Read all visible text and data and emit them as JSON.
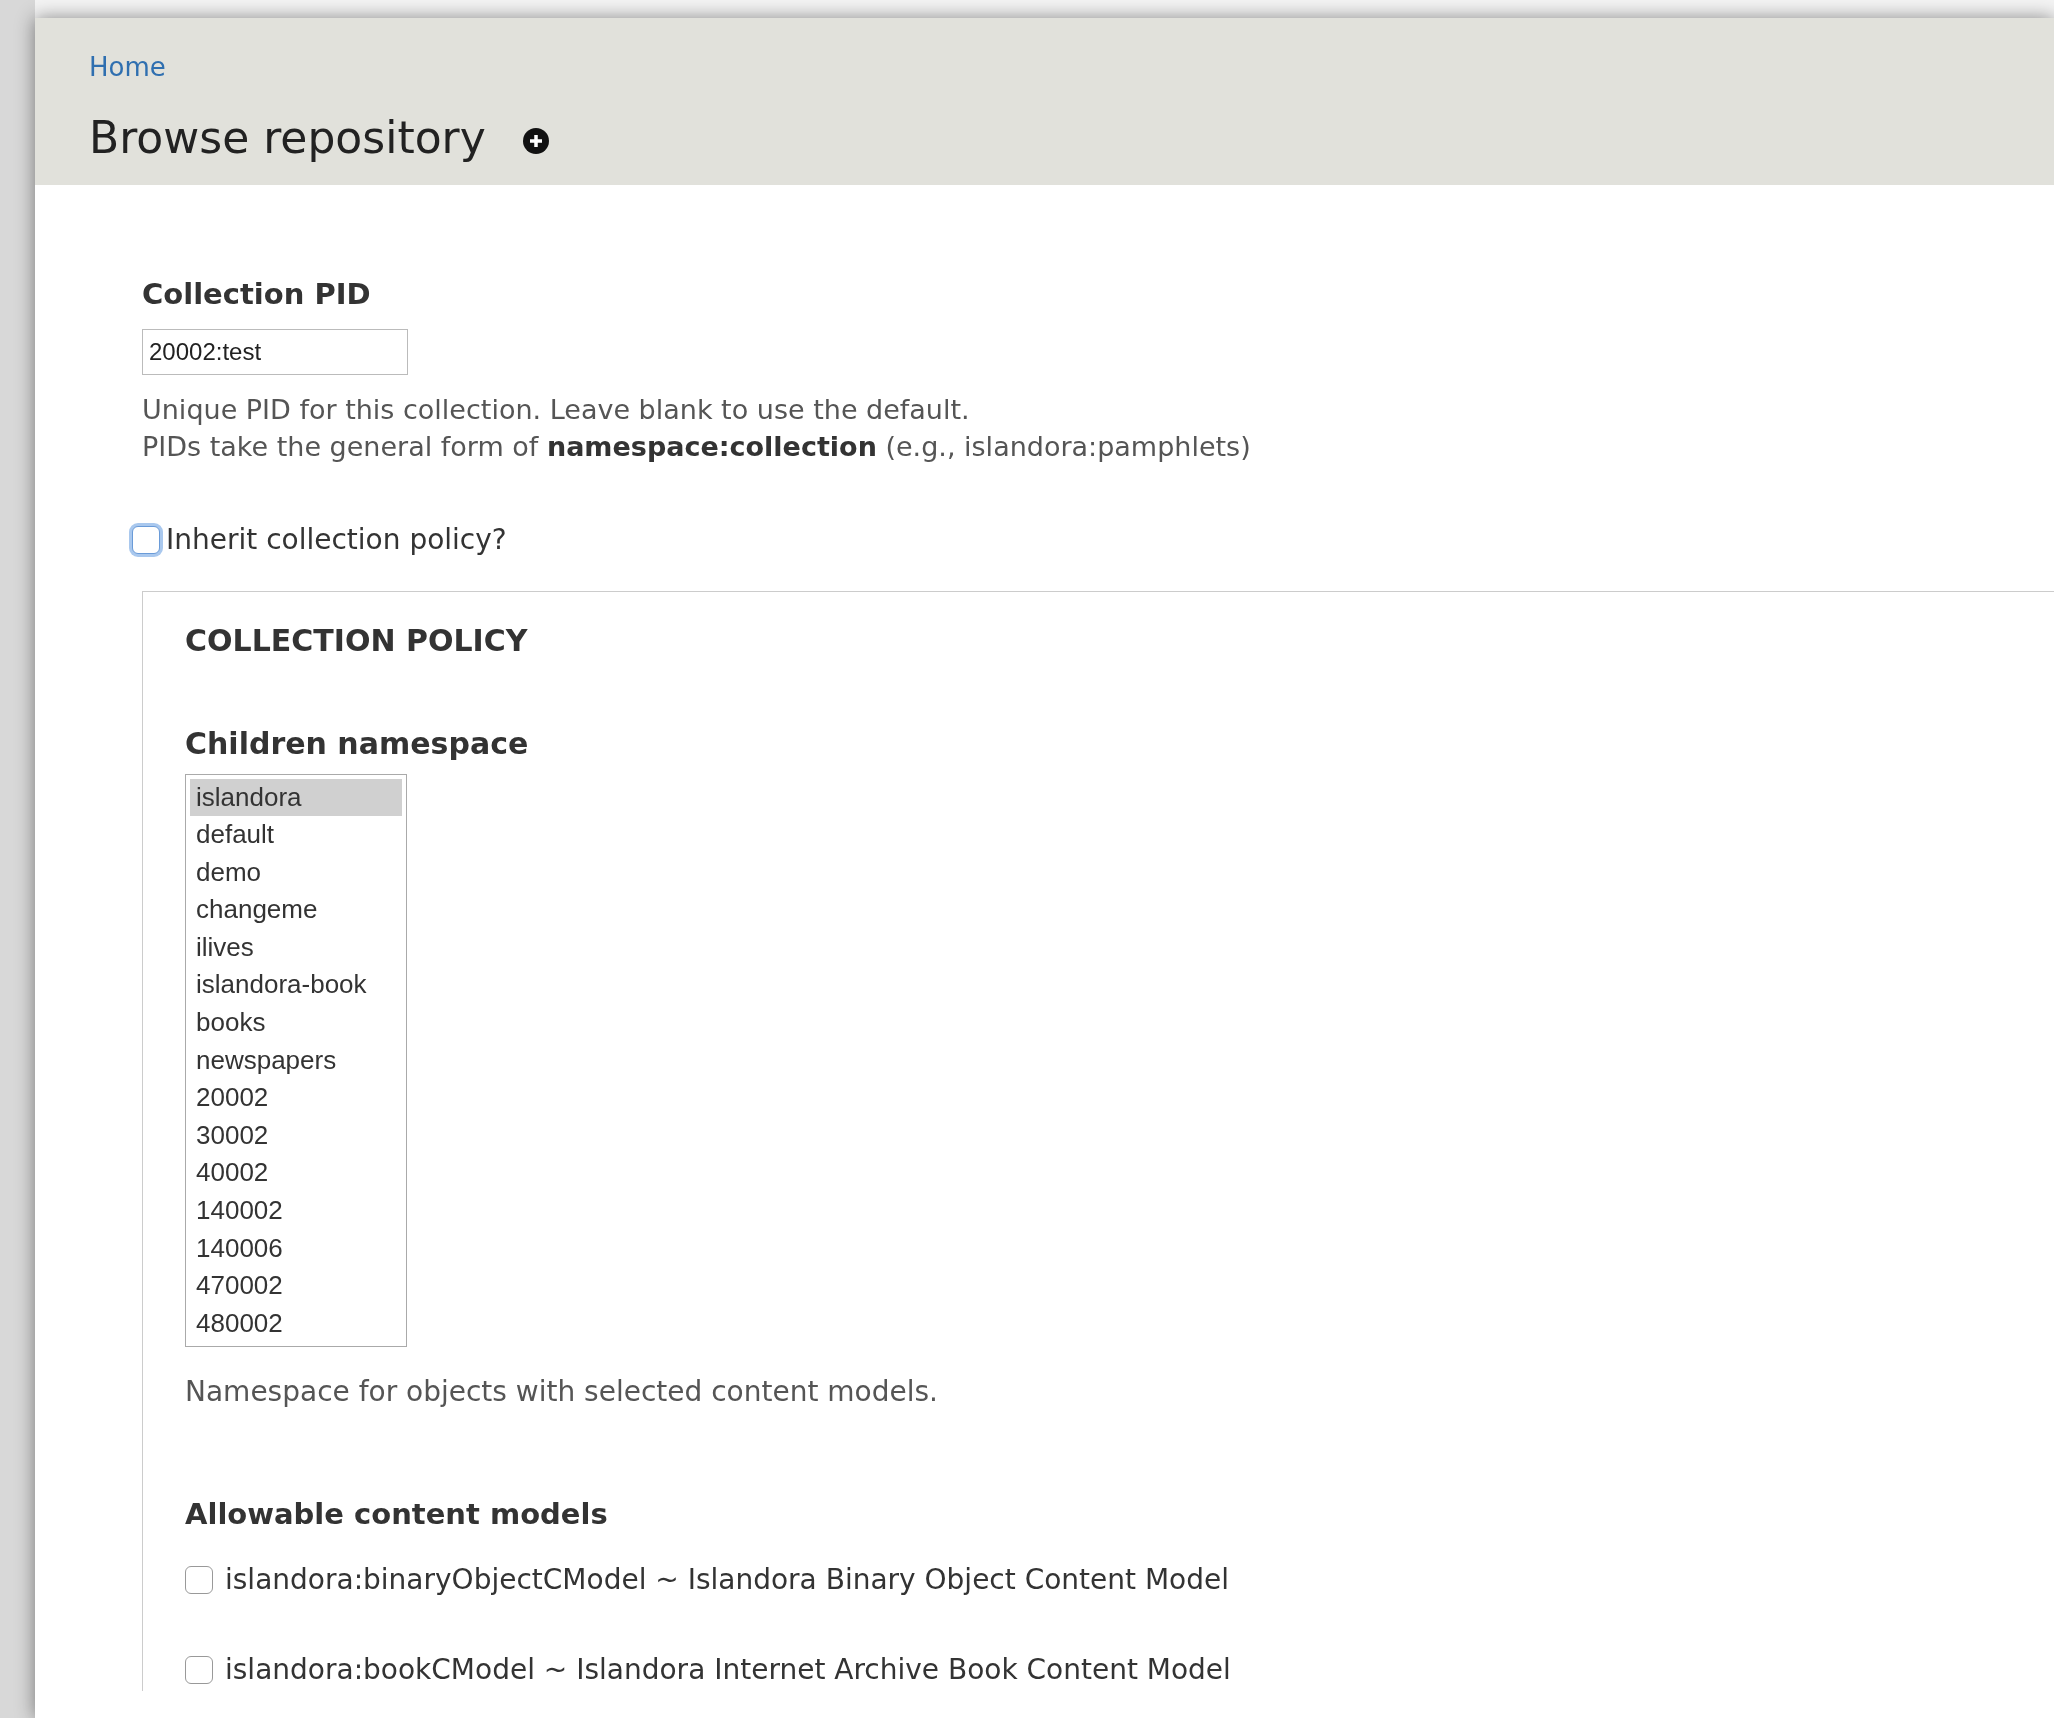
{
  "breadcrumb": {
    "label": "Home"
  },
  "page_title": "Browse repository",
  "collection_pid": {
    "label": "Collection PID",
    "value": "20002:test",
    "help": [
      "Unique PID for this collection. Leave blank to use the default.",
      "PIDs take the general form of **namespace:collection** (e.g., islandora:pamphlets)"
    ]
  },
  "inherit_policy": {
    "label": "Inherit collection policy?",
    "checked": false
  },
  "collection_policy": {
    "legend": "COLLECTION POLICY",
    "children_namespace": {
      "label": "Children namespace",
      "options": [
        {
          "label": "islandora",
          "selected": true
        },
        {
          "label": "default",
          "selected": false
        },
        {
          "label": "demo",
          "selected": false
        },
        {
          "label": "changeme",
          "selected": false
        },
        {
          "label": "ilives",
          "selected": false
        },
        {
          "label": "islandora-book",
          "selected": false
        },
        {
          "label": "books",
          "selected": false
        },
        {
          "label": "newspapers",
          "selected": false
        },
        {
          "label": "20002",
          "selected": false
        },
        {
          "label": "30002",
          "selected": false
        },
        {
          "label": "40002",
          "selected": false
        },
        {
          "label": "140002",
          "selected": false
        },
        {
          "label": "140006",
          "selected": false
        },
        {
          "label": "470002",
          "selected": false
        },
        {
          "label": "480002",
          "selected": false
        }
      ],
      "help": "Namespace for objects with selected content models."
    },
    "content_models": {
      "label": "Allowable content models",
      "items": [
        {
          "label": "islandora:binaryObjectCModel ~ Islandora Binary Object Content Model",
          "checked": false
        },
        {
          "label": "islandora:bookCModel ~ Islandora Internet Archive Book Content Model",
          "checked": false
        }
      ]
    }
  }
}
